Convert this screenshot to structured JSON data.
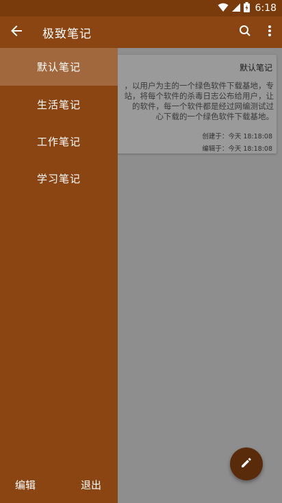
{
  "status_bar": {
    "time": "6:18",
    "icons": [
      "wifi-icon",
      "signal-icon",
      "battery-icon"
    ]
  },
  "app_bar": {
    "title": "极致笔记",
    "icons": [
      "back-arrow-icon",
      "search-icon",
      "more-vert-icon"
    ]
  },
  "note": {
    "category": "默认笔记",
    "body": "，以用户为主的一个绿色软件下载基地，专\n站，将每个软件的杀毒日志公布给用户，让\n的软件，每一个软件都是经过网编测试过\n心下载的一个绿色软件下载基地。",
    "created": "创建于：今天  18:18:08",
    "edited": "编辑于：今天  18:18:08"
  },
  "drawer": {
    "items": [
      {
        "label": "默认笔记",
        "selected": true
      },
      {
        "label": "生活笔记",
        "selected": false
      },
      {
        "label": "工作笔记",
        "selected": false
      },
      {
        "label": "学习笔记",
        "selected": false
      }
    ],
    "edit_label": "编辑",
    "exit_label": "退出"
  },
  "fab": {
    "icon": "pencil-icon"
  },
  "colors": {
    "primary": "#8b4513",
    "status_bar": "#7a3b0c",
    "drawer_selected": "#a0683c",
    "fab": "#5a2b0a",
    "scrim_background": "#8e8e8e"
  }
}
